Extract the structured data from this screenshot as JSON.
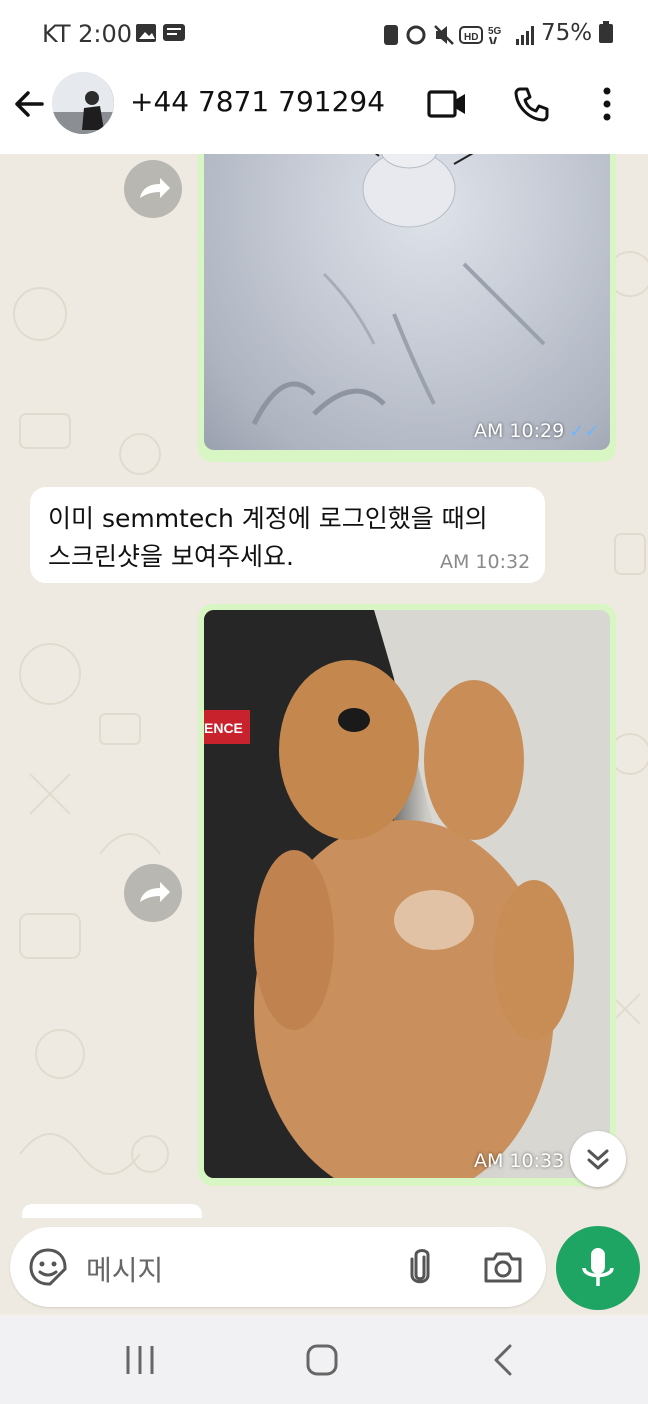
{
  "status_bar": {
    "time": "KT 2:00",
    "battery": "75%",
    "network": "5G"
  },
  "header": {
    "contact": "+44 7871 791294"
  },
  "messages": {
    "image1_time": "AM 10:29",
    "text_line1": "이미 semmtech 계정에 로그인했을 때의",
    "text_line2": "스크린샷을 보여주세요.",
    "text_time": "AM 10:32",
    "image2_time": "AM 10:33",
    "ticks": "✓✓",
    "shirt_text": "ENCE"
  },
  "composer": {
    "placeholder": "메시지"
  },
  "colors": {
    "accent": "#1ea463",
    "outgoing": "#d7f6c3",
    "read_ticks": "#6ab7ff"
  }
}
